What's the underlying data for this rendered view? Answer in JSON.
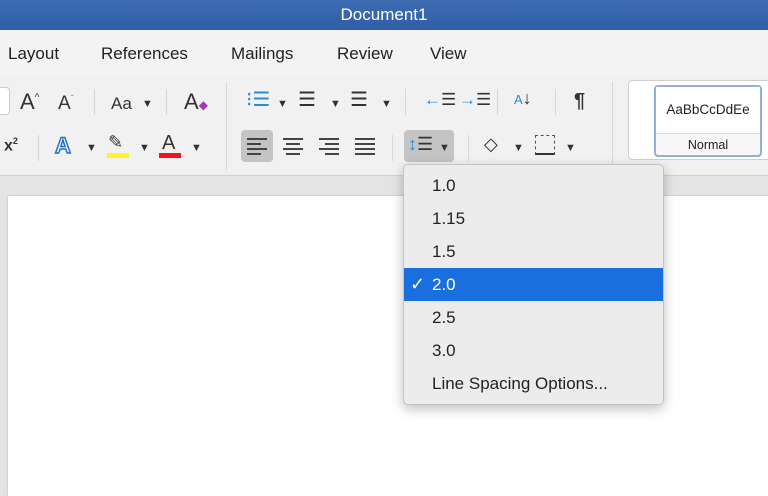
{
  "window": {
    "title": "Document1"
  },
  "tabs": [
    "Layout",
    "References",
    "Mailings",
    "Review",
    "View"
  ],
  "ribbon": {
    "case_label": "Aa",
    "superscript": "x",
    "superscript_exp": "2",
    "pilcrow": "¶",
    "style_preview": "AaBbCcDdEe",
    "style_name": "Normal"
  },
  "colors": {
    "highlight": "#fff22a",
    "font_color": "#f0141e",
    "accent": "#1a6fde",
    "title": "#345fa8"
  },
  "line_spacing_menu": {
    "items": [
      {
        "label": "1.0"
      },
      {
        "label": "1.15"
      },
      {
        "label": "1.5"
      },
      {
        "label": "2.0",
        "selected": true
      },
      {
        "label": "2.5"
      },
      {
        "label": "3.0"
      },
      {
        "label": "Line Spacing Options..."
      }
    ],
    "check": "✓"
  }
}
